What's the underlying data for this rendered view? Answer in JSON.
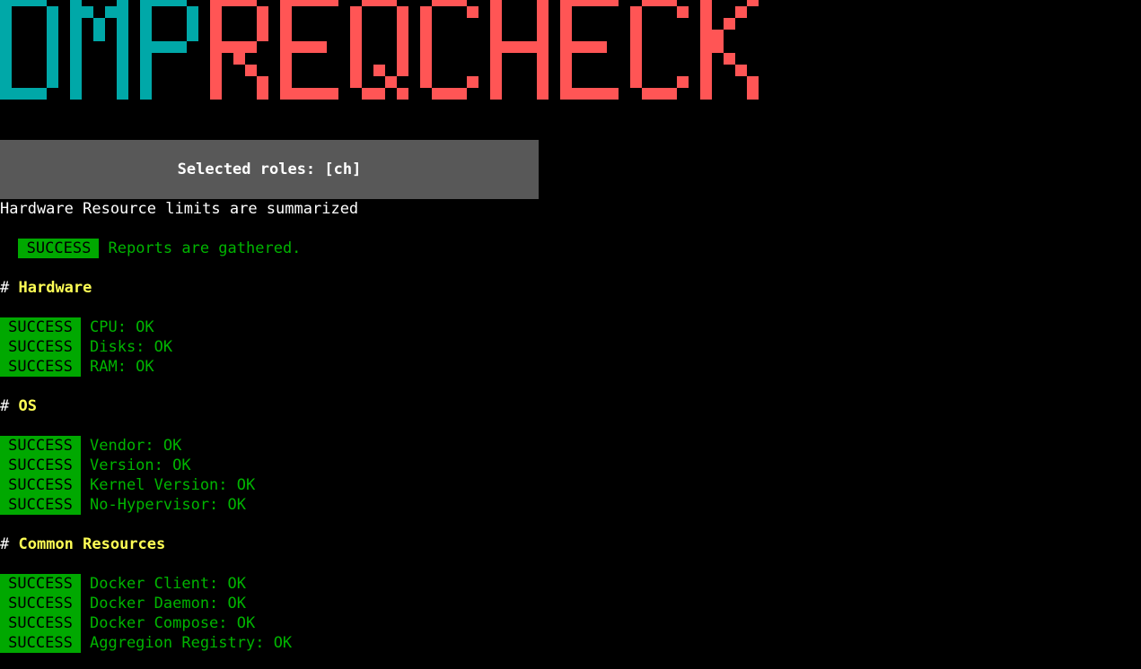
{
  "banner": {
    "text_left": "DMP",
    "text_right": "REQCHECK",
    "color_left": "#00a8a8",
    "color_right": "#ff5555"
  },
  "roles_label": "Selected roles: [ch]",
  "summary_line": "Hardware Resource limits are summarized",
  "badge_label": "SUCCESS",
  "gathered_msg": "Reports are gathered.",
  "sections": [
    {
      "hash": "#",
      "title": "Hardware",
      "checks": [
        "CPU: OK",
        "Disks: OK",
        "RAM: OK"
      ]
    },
    {
      "hash": "#",
      "title": "OS",
      "checks": [
        "Vendor: OK",
        "Version: OK",
        "Kernel Version: OK",
        "No-Hypervisor: OK"
      ]
    },
    {
      "hash": "#",
      "title": "Common Resources",
      "checks": [
        "Docker Client: OK",
        "Docker Daemon: OK",
        "Docker Compose: OK",
        "Aggregion Registry: OK"
      ]
    }
  ],
  "colors": {
    "background": "#000000",
    "badge_bg": "#00a800",
    "ok_text": "#00b400",
    "heading": "#ffff55",
    "roles_bg": "#585858"
  }
}
